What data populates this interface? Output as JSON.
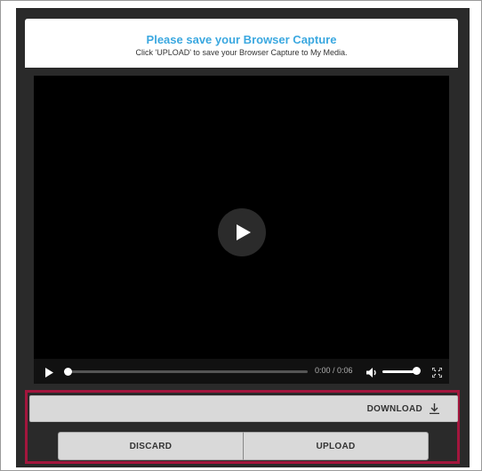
{
  "dialog": {
    "title": "Please save your Browser Capture",
    "subtitle": "Click 'UPLOAD' to save your Browser Capture to My Media."
  },
  "player": {
    "current_time": "0:00",
    "separator": " / ",
    "duration": "0:06",
    "progress": 0,
    "volume": 1.0,
    "icons": [
      "play-icon",
      "volume-icon",
      "fullscreen-icon"
    ]
  },
  "actions": {
    "download_label": "DOWNLOAD",
    "discard_label": "DISCARD",
    "upload_label": "UPLOAD"
  },
  "colors": {
    "title_accent": "#3ba8e0",
    "highlight_border": "#a3163d",
    "button_bg": "#d9d9d9",
    "dialog_bg": "#2a2a2a"
  }
}
